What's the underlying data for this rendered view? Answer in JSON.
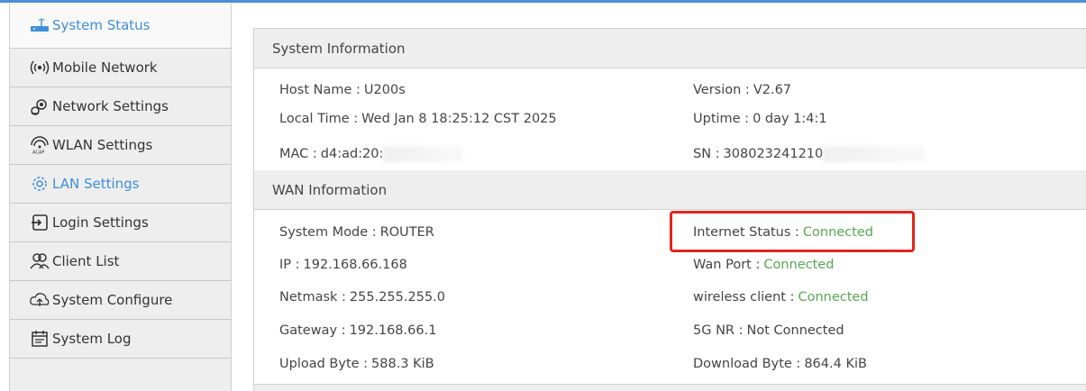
{
  "sidebar": {
    "items": [
      {
        "label": "System Status",
        "icon": "router-icon"
      },
      {
        "label": "Mobile Network",
        "icon": "signal-icon"
      },
      {
        "label": "Network Settings",
        "icon": "network-settings-icon"
      },
      {
        "label": "WLAN Settings",
        "icon": "wlan-icon"
      },
      {
        "label": "LAN Settings",
        "icon": "gear-icon"
      },
      {
        "label": "Login Settings",
        "icon": "login-icon"
      },
      {
        "label": "Client List",
        "icon": "users-icon"
      },
      {
        "label": "System Configure",
        "icon": "upload-cloud-icon"
      },
      {
        "label": "System Log",
        "icon": "calendar-icon"
      }
    ],
    "active_color": "#3f8fd8"
  },
  "system_info": {
    "title": "System Information",
    "host_name_label": "Host Name :",
    "host_name": "U200s",
    "version_label": "Version :",
    "version": "V2.67",
    "local_time_label": "Local Time :",
    "local_time": "Wed Jan 8 18:25:12 CST 2025",
    "uptime_label": "Uptime :",
    "uptime": "0 day 1:4:1",
    "mac_label": "MAC :",
    "mac": "d4:ad:20:",
    "sn_label": "SN :",
    "sn": "308023241210"
  },
  "wan_info": {
    "title": "WAN Information",
    "system_mode_label": "System Mode :",
    "system_mode": "ROUTER",
    "internet_status_label": "Internet Status :",
    "internet_status": "Connected",
    "ip_label": "IP :",
    "ip": "192.168.66.168",
    "wan_port_label": "Wan Port :",
    "wan_port": "Connected",
    "netmask_label": "Netmask :",
    "netmask": "255.255.255.0",
    "wireless_client_label": "wireless client :",
    "wireless_client": "Connected",
    "gateway_label": "Gateway :",
    "gateway": "192.168.66.1",
    "nr_label": "5G NR :",
    "nr": "Not Connected",
    "upload_label": "Upload Byte :",
    "upload": "588.3 KiB",
    "download_label": "Download Byte :",
    "download": "864.4 KiB"
  },
  "colors": {
    "accent": "#3f8fd8",
    "status_ok": "#55a84f",
    "highlight": "#e3241b"
  }
}
